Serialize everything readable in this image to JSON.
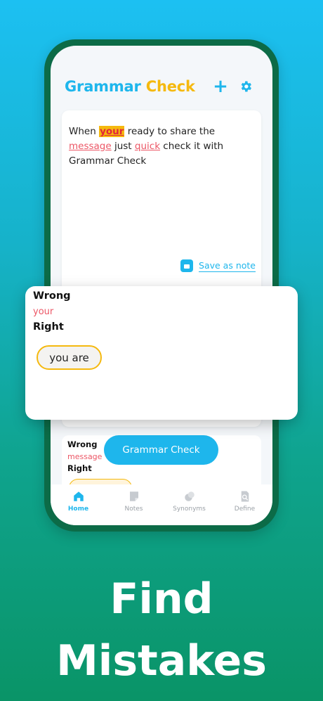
{
  "app": {
    "brand_part1": "Grammar",
    "brand_part2": "Check"
  },
  "editor": {
    "text_1": "When ",
    "error_1": "your",
    "text_2": " ready to share the ",
    "error_2": "message",
    "text_3": " just ",
    "error_3": "quick",
    "text_4": " check it with Grammar Check",
    "save_label": "Save as note"
  },
  "popup": {
    "wrong_label": "Wrong",
    "wrong_word": "your",
    "right_label": "Right",
    "suggestion": "you are"
  },
  "card2": {
    "wrong_label": "Wrong",
    "wrong_word": "message",
    "right_label": "Right"
  },
  "action_button": "Grammar Check",
  "tabs": [
    {
      "label": "Home",
      "icon": "home-icon",
      "active": true
    },
    {
      "label": "Notes",
      "icon": "notes-icon",
      "active": false
    },
    {
      "label": "Synonyms",
      "icon": "synonyms-icon",
      "active": false
    },
    {
      "label": "Define",
      "icon": "define-icon",
      "active": false
    }
  ],
  "caption": {
    "line1": "Find",
    "line2": "Mistakes"
  },
  "colors": {
    "accent": "#1eb6ec",
    "highlight": "#f5b90f",
    "error": "#ec5766",
    "frame": "#0c6b47"
  }
}
